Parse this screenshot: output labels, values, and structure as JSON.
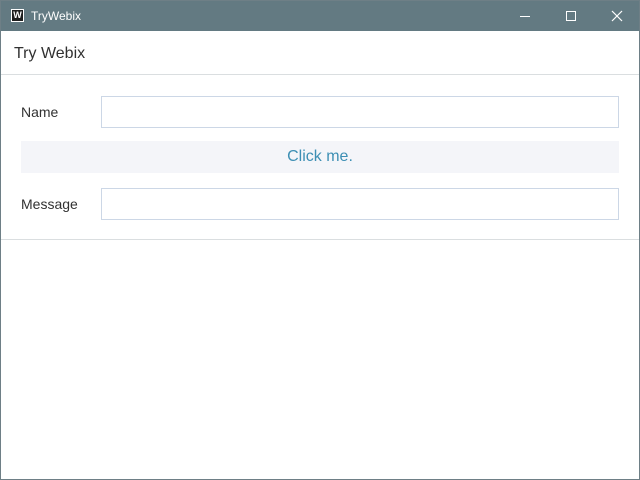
{
  "window": {
    "title": "TryWebix",
    "icon": "W",
    "controls": {
      "minimize": "minimize-icon",
      "maximize": "maximize-icon",
      "close": "close-icon"
    }
  },
  "header": {
    "title": "Try Webix"
  },
  "form": {
    "name_label": "Name",
    "name_value": "",
    "button_label": "Click me.",
    "message_label": "Message",
    "message_value": ""
  },
  "colors": {
    "titlebar": "#637a82",
    "button_text": "#3d8fb4",
    "button_bg": "#f4f5f9"
  }
}
